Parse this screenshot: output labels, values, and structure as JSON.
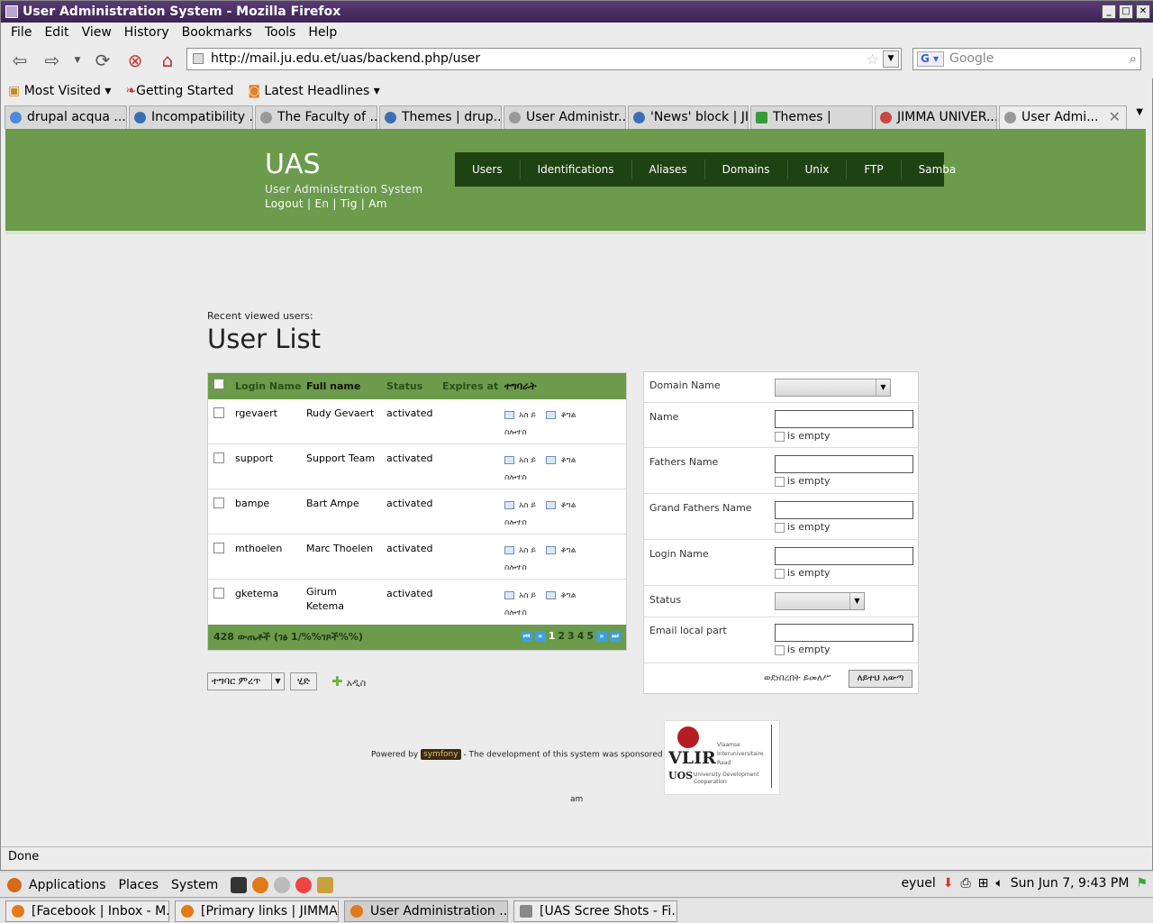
{
  "window": {
    "title": "User Administration System - Mozilla Firefox"
  },
  "menu": [
    "File",
    "Edit",
    "View",
    "History",
    "Bookmarks",
    "Tools",
    "Help"
  ],
  "address": {
    "url": "http://mail.ju.edu.et/uas/backend.php/user",
    "search_placeholder": "Google"
  },
  "bookmarks": [
    "Most Visited",
    "Getting Started",
    "Latest Headlines"
  ],
  "tabs": [
    "drupal acqua ...",
    "Incompatibility ...",
    "The Faculty of ...",
    "Themes | drup...",
    "User Administr...",
    "'News' block | JI...",
    "Themes |",
    "JIMMA UNIVER...",
    "User Admi..."
  ],
  "site": {
    "logo": "UAS",
    "subtitle": "User Administration System",
    "langs": "Logout | En | Tig | Am",
    "nav": [
      "Users",
      "Identifications",
      "Aliases",
      "Domains",
      "Unix",
      "FTP",
      "Samba"
    ]
  },
  "recent_label": "Recent viewed users:",
  "heading": "User List",
  "table": {
    "headers": [
      "Login Name",
      "Full name",
      "Status",
      "Expires at",
      "ተግባራት"
    ],
    "rows": [
      {
        "login": "rgevaert",
        "name": "Rudy Gevaert",
        "status": "activated"
      },
      {
        "login": "support",
        "name": "Support Team",
        "status": "activated"
      },
      {
        "login": "bampe",
        "name": "Bart Ampe",
        "status": "activated"
      },
      {
        "login": "mthoelen",
        "name": "Marc Thoelen",
        "status": "activated"
      },
      {
        "login": "gketema",
        "name": "Girum Ketema",
        "status": "activated"
      }
    ],
    "action_edit": "አስ ይ",
    "action_tag": "ቆግል",
    "action_delete": "ስሎተስ",
    "count": "428 ውጤቶች (ገፅ 1/%%ገጾች%%)",
    "pages": [
      "1",
      "2",
      "3",
      "4",
      "5"
    ]
  },
  "batch": {
    "select": "ተግባር ምረጥ",
    "go": "ሂድ",
    "add": "አዲስ"
  },
  "filter": {
    "domain": "Domain Name",
    "name": "Name",
    "fathers": "Fathers Name",
    "grand": "Grand Fathers Name",
    "login": "Login Name",
    "status": "Status",
    "email": "Email local part",
    "is_empty": "is empty",
    "reset": "ወደነበረበት ይመለሥ",
    "submit": "ለይተህ አውጣ"
  },
  "footer": {
    "powered": "Powered by",
    "symfony": "symfony",
    "sponsor": "- The development of this system was sponsored by",
    "lang": "am",
    "vlir1": "VLIR",
    "vlir2": "UOS",
    "vlir3": "Vlaamse Interuniversitaire Raad",
    "vlir4": "University Development Cooperation"
  },
  "statusbar": "Done",
  "panel": {
    "apps": "Applications",
    "places": "Places",
    "system": "System",
    "user": "eyuel",
    "clock": "Sun Jun  7,  9:43 PM"
  },
  "tasks": [
    "[Facebook | Inbox - M...",
    "[Primary links | JIMMA...",
    "User Administration ...",
    "[UAS Scree Shots - Fi..."
  ]
}
